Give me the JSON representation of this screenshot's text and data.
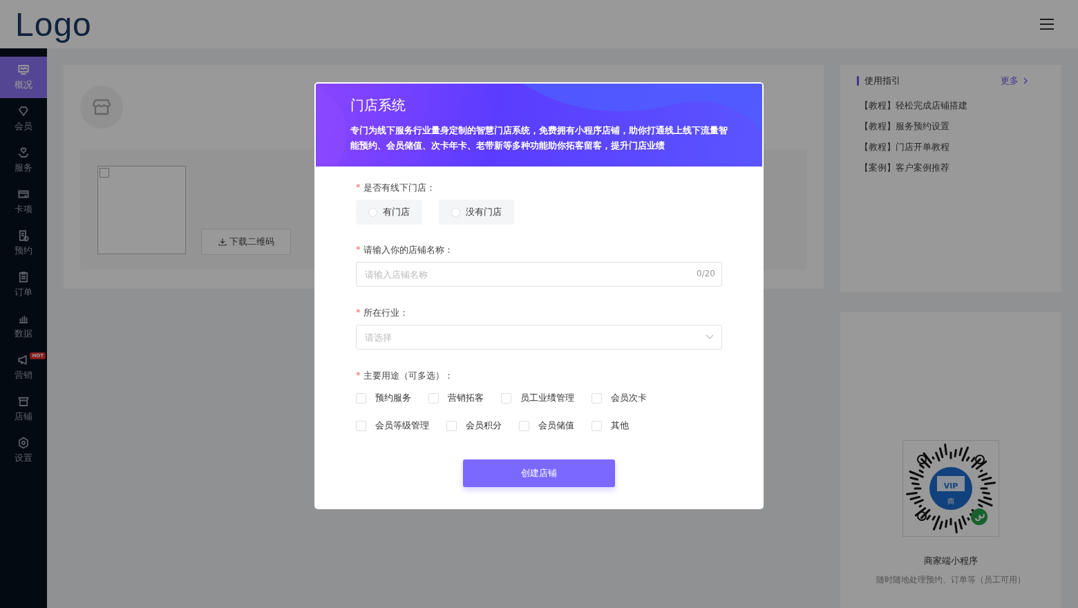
{
  "header": {
    "logo": "Logo"
  },
  "sidebar": {
    "items": [
      {
        "label": "概况",
        "selected": true
      },
      {
        "label": "会员",
        "selected": false
      },
      {
        "label": "服务",
        "selected": false
      },
      {
        "label": "卡项",
        "selected": false
      },
      {
        "label": "预约",
        "selected": false
      },
      {
        "label": "订单",
        "selected": false
      },
      {
        "label": "数据",
        "selected": false
      },
      {
        "label": "营销",
        "selected": false,
        "badge": "HOT"
      },
      {
        "label": "店铺",
        "selected": false
      },
      {
        "label": "设置",
        "selected": false
      }
    ]
  },
  "store_card": {
    "download_button": "下载二维码"
  },
  "guide": {
    "title": "使用指引",
    "more": "更多",
    "items": [
      "【教程】轻松完成店铺搭建",
      "【教程】服务预约设置",
      "【教程】门店开单教程",
      "【案例】客户案例推荐"
    ]
  },
  "mini_program": {
    "title": "商家端小程序",
    "subtitle": "随时随地处理预约、订单等（员工可用）",
    "qr_center": "VIP",
    "qr_sub": "商"
  },
  "modal": {
    "title": "门店系统",
    "description": "专门为线下服务行业量身定制的智慧门店系统，免费拥有小程序店铺，助你打通线上线下流量智能预约、会员储值、次卡年卡、老带新等多种功能助你拓客留客，提升门店业绩",
    "has_store": {
      "required_mark": "*",
      "label": "是否有线下门店：",
      "options": [
        {
          "label": "有门店",
          "selected": false
        },
        {
          "label": "没有门店",
          "selected": false
        }
      ]
    },
    "store_name": {
      "required_mark": "*",
      "label": "请输入你的店铺名称：",
      "placeholder": "请输入店铺名称",
      "counter": "0/20"
    },
    "industry": {
      "required_mark": "*",
      "label": "所在行业：",
      "placeholder": "请选择"
    },
    "purposes": {
      "required_mark": "*",
      "label": "主要用途（可多选）：",
      "options": [
        {
          "label": "预约服务",
          "checked": false
        },
        {
          "label": "营销拓客",
          "checked": false
        },
        {
          "label": "员工业绩管理",
          "checked": false
        },
        {
          "label": "会员次卡",
          "checked": false
        },
        {
          "label": "会员等级管理",
          "checked": false
        },
        {
          "label": "会员积分",
          "checked": false
        },
        {
          "label": "会员储值",
          "checked": false
        },
        {
          "label": "其他",
          "checked": false
        }
      ]
    },
    "submit": "创建店铺"
  }
}
